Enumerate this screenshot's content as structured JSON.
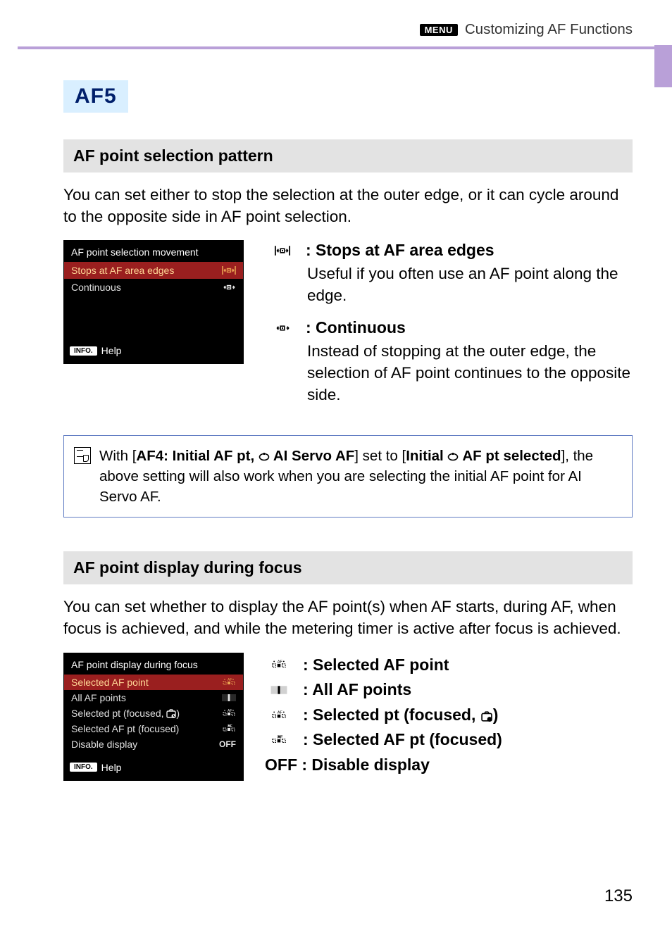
{
  "header": {
    "menu_label": "MENU",
    "crumb": "Customizing AF Functions"
  },
  "af5_label": "AF5",
  "section1": {
    "title": "AF point selection pattern",
    "intro": "You can set either to stop the selection at the outer edge, or it can cycle around to the opposite side in AF point selection.",
    "shot_title": "AF point selection movement",
    "shot_items": [
      {
        "label": "Stops at AF area edges",
        "selected": true
      },
      {
        "label": "Continuous",
        "selected": false
      }
    ],
    "info_label": "INFO.",
    "help_label": "Help",
    "opt1_title": ": Stops at AF area edges",
    "opt1_desc": "Useful if you often use an AF point along the edge.",
    "opt2_title": ": Continuous",
    "opt2_desc": "Instead of stopping at the outer edge, the selection of AF point continues to the opposite side."
  },
  "note": {
    "part1": "With [",
    "af4_bold": "AF4",
    "part2": ": Initial AF pt, ",
    "ai_servo_bold": " AI Servo AF",
    "part3": "] set to [",
    "initial_bold": "Initial ",
    "af_pt_bold": " AF pt selected",
    "part4": "], the above setting will also work when you are selecting the initial AF point for AI Servo AF."
  },
  "section2": {
    "title": "AF point display during focus",
    "intro": "You can set whether to display the AF point(s) when AF starts, during AF, when focus is achieved, and while the metering timer is active after focus is achieved.",
    "shot_title": "AF point display during focus",
    "shot_items": [
      {
        "label": "Selected AF point",
        "icon": "sel",
        "selected": true
      },
      {
        "label": "All AF points",
        "icon": "all",
        "selected": false
      },
      {
        "label": "Selected pt (focused, ",
        "icon": "sel-timer",
        "selected": false,
        "has_timer": true
      },
      {
        "label": "Selected AF pt (focused)",
        "icon": "sel-solid",
        "selected": false
      },
      {
        "label": "Disable display",
        "icon": "off",
        "selected": false
      }
    ],
    "info_label": "INFO.",
    "help_label": "Help",
    "options": [
      {
        "icon": "sel",
        "label": ": Selected AF point"
      },
      {
        "icon": "all",
        "label": ": All AF points"
      },
      {
        "icon": "sel-timer",
        "label_pre": ": Selected pt (focused, ",
        "label_post": ")",
        "has_timer": true
      },
      {
        "icon": "sel-solid",
        "label": ": Selected AF pt (focused)"
      },
      {
        "icon": "off",
        "label": "OFF : Disable display"
      }
    ]
  },
  "page_number": "135"
}
